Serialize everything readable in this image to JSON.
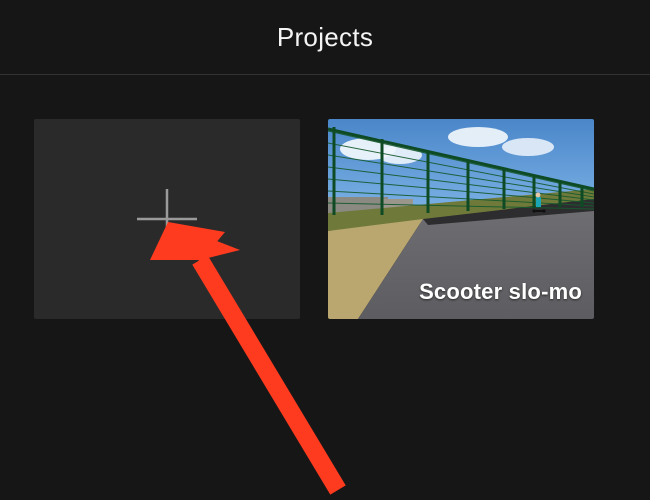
{
  "header": {
    "title": "Projects"
  },
  "tiles": {
    "new_project": {
      "icon": "plus-icon"
    },
    "project_0": {
      "label": "Scooter slo-mo"
    }
  },
  "annotation": {
    "arrow_color": "#ff3b1f"
  }
}
